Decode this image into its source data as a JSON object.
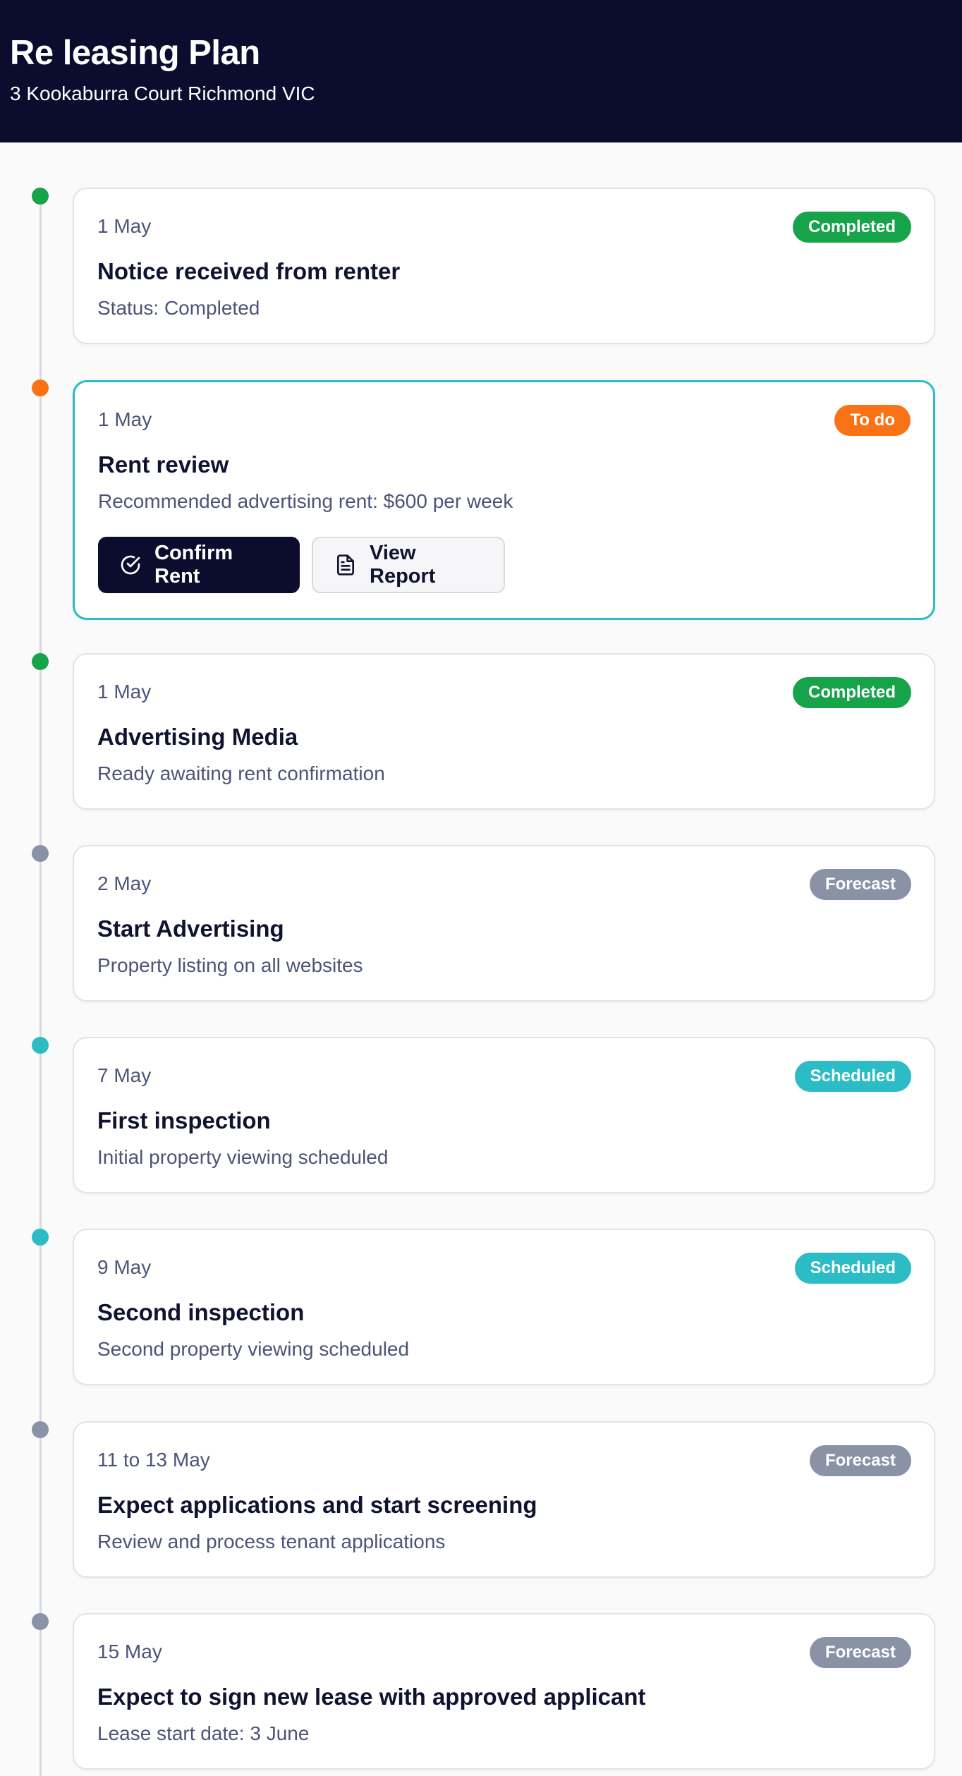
{
  "header": {
    "title": "Re leasing Plan",
    "address": "3 Kookaburra Court Richmond VIC"
  },
  "colors": {
    "completed": "#16a34a",
    "todo": "#f97316",
    "forecast": "#8a92a6",
    "scheduled": "#2bbcc6",
    "header_bg": "#0c0d2e",
    "active_border": "#2bbcc6"
  },
  "steps": [
    {
      "date": "1 May",
      "title": "Notice received from renter",
      "description": "Status: Completed",
      "status": "Completed"
    },
    {
      "date": "1 May",
      "title": "Rent review",
      "description": "Recommended advertising rent: $600 per week",
      "status": "To do",
      "actions": {
        "confirm_label": "Confirm Rent",
        "confirm_icon": "check-circle-icon",
        "report_label": "View Report",
        "report_icon": "document-icon"
      }
    },
    {
      "date": "1 May",
      "title": "Advertising Media",
      "description": "Ready awaiting rent confirmation",
      "status": "Completed"
    },
    {
      "date": "2 May",
      "title": "Start Advertising",
      "description": "Property listing on all websites",
      "status": "Forecast"
    },
    {
      "date": "7 May",
      "title": "First inspection",
      "description": "Initial property viewing scheduled",
      "status": "Scheduled"
    },
    {
      "date": "9 May",
      "title": "Second inspection",
      "description": "Second property viewing scheduled",
      "status": "Scheduled"
    },
    {
      "date": "11 to 13 May",
      "title": "Expect applications and start screening",
      "description": "Review and process tenant applications",
      "status": "Forecast"
    },
    {
      "date": "15 May",
      "title": "Expect to sign new lease with approved applicant",
      "description": "Lease start date: 3 June",
      "status": "Forecast"
    }
  ]
}
